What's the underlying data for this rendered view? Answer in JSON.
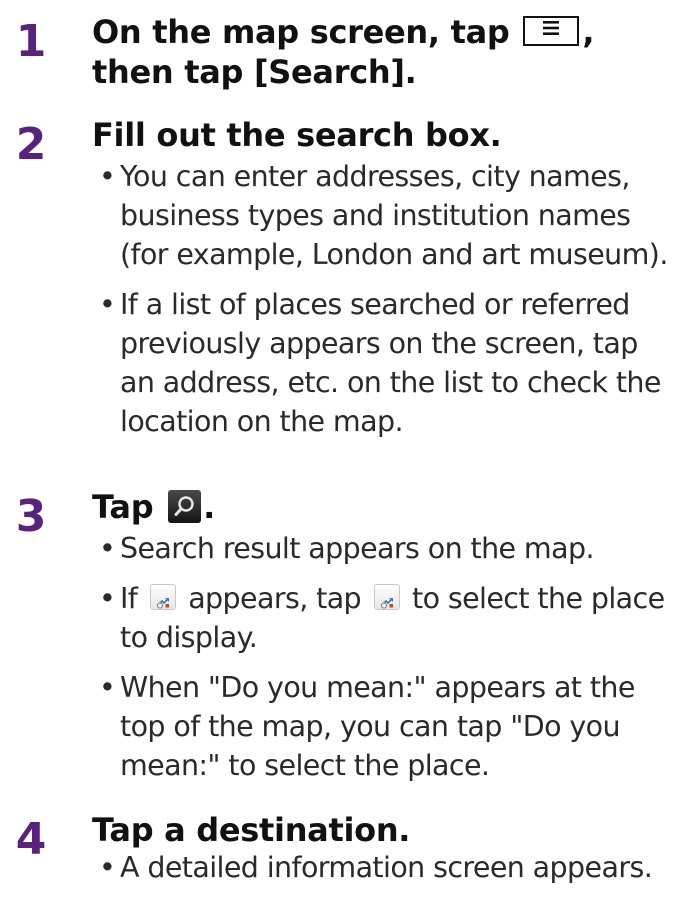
{
  "steps": [
    {
      "number": "1",
      "heading": {
        "part1": "On the map screen, tap",
        "menu_icon": "menu-icon",
        "part2": ", then tap [Search]."
      }
    },
    {
      "number": "2",
      "heading": {
        "text": "Fill out the search box."
      },
      "bullets": [
        "You can enter addresses, city names, business types and institution names (for example, London and art museum).",
        "If a list of places searched or referred previously appears on the screen, tap an address, etc. on the list to check the location on the map."
      ]
    },
    {
      "number": "3",
      "heading": {
        "part1": "Tap",
        "search_icon": "search-icon",
        "part2": "."
      },
      "bullets": [
        {
          "text": "Search result appears on the map."
        },
        {
          "part1": "If",
          "icon": "place-list-icon",
          "part2": "appears, tap",
          "part3": "to select the place to display."
        },
        {
          "text": "When \"Do you mean:\" appears at the top of the map, you can tap \"Do you mean:\" to select the place."
        }
      ]
    },
    {
      "number": "4",
      "heading": {
        "text": "Tap a destination."
      },
      "bullets": [
        "A detailed information screen appears."
      ]
    }
  ]
}
